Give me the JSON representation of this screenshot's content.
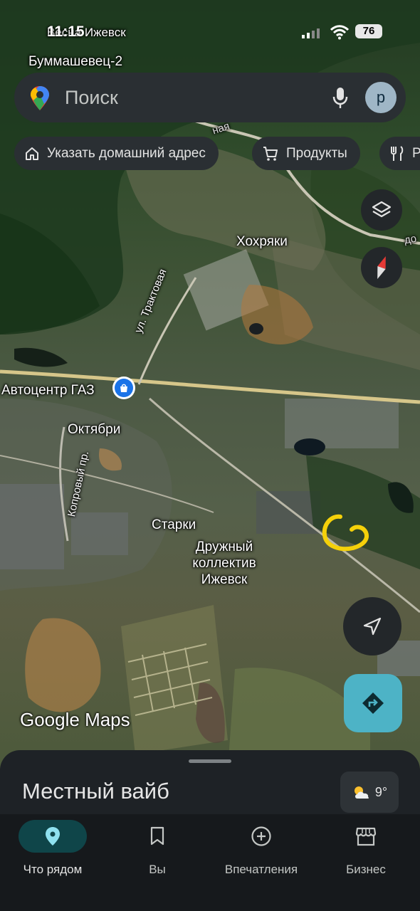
{
  "status_bar": {
    "time": "11:15",
    "battery": "76"
  },
  "search": {
    "placeholder": "Поиск",
    "avatar_letter": "р"
  },
  "chips": [
    {
      "label": "Указать домашний адрес",
      "icon": "home-icon"
    },
    {
      "label": "Продукты",
      "icon": "cart-icon"
    },
    {
      "label": "Р",
      "icon": "restaurant-icon"
    }
  ],
  "map_labels": {
    "vesna": "Весна Ижевск",
    "bummashevets": "Буммашевец-2",
    "hohryaki": "Хохряки",
    "traktovaya": "ул. Трактовая",
    "avtocentr": "Автоцентр ГАЗ",
    "oktyabri": "Октябри",
    "koprovy": "Копровый пр.",
    "starki": "Старки",
    "druzhny_1": "Дружный",
    "druzhny_2": "коллектив",
    "druzhny_3": "Ижевск",
    "road_top": "ная",
    "road_right": "до"
  },
  "watermark": "Google Maps",
  "sheet": {
    "title": "Местный вайб",
    "temperature": "9°"
  },
  "nav": {
    "items": [
      {
        "label": "Что рядом",
        "icon": "pin-icon",
        "active": true
      },
      {
        "label": "Вы",
        "icon": "bookmark-icon",
        "active": false
      },
      {
        "label": "Впечатления",
        "icon": "plus-circle-icon",
        "active": false
      },
      {
        "label": "Бизнес",
        "icon": "store-icon",
        "active": false
      }
    ]
  },
  "colors": {
    "accent": "#4db3c6",
    "annotation": "#f5d10a",
    "nav_active_pill": "#0f4549"
  }
}
